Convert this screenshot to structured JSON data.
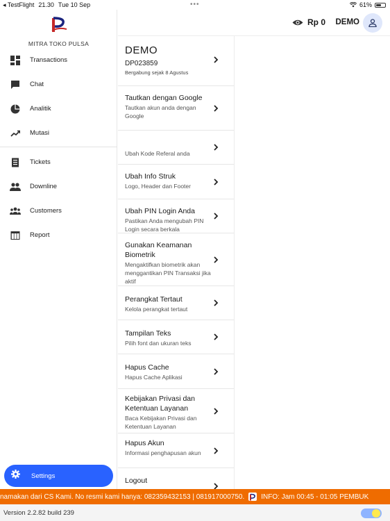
{
  "status_bar": {
    "back_app": "◂ TestFlight",
    "time": "21.30",
    "date": "Tue 10 Sep",
    "battery": "61%",
    "battery_level": 0.61
  },
  "brand": {
    "name": "MITRA TOKO PULSA"
  },
  "sidebar": {
    "group1": [
      {
        "label": "Transactions",
        "icon": "dashboard-icon"
      },
      {
        "label": "Chat",
        "icon": "chat-icon"
      },
      {
        "label": "Analitik",
        "icon": "pie-chart-icon"
      },
      {
        "label": "Mutasi",
        "icon": "trending-up-icon"
      }
    ],
    "group2": [
      {
        "label": "Tickets",
        "icon": "receipt-icon"
      },
      {
        "label": "Downline",
        "icon": "people-icon"
      },
      {
        "label": "Customers",
        "icon": "groups-icon"
      },
      {
        "label": "Report",
        "icon": "table-icon"
      }
    ],
    "settings_label": "Settings"
  },
  "header": {
    "balance": "Rp 0",
    "user": "DEMO"
  },
  "profile": {
    "name": "DEMO",
    "id": "DP023859",
    "joined": "Bergabung sejak 8 Agustus"
  },
  "settings": [
    {
      "title": "Tautkan dengan Google",
      "sub": "Tautkan akun anda dengan Google"
    },
    {
      "title": "",
      "sub": "Ubah Kode Referal anda"
    },
    {
      "title": "Ubah Info Struk",
      "sub": "Logo, Header dan Footer"
    },
    {
      "title": "Ubah PIN Login Anda",
      "sub": "Pastikan Anda mengubah PIN Login secara berkala"
    },
    {
      "title": "Gunakan Keamanan Biometrik",
      "sub": "Mengaktifkan biometrik akan menggantikan PIN Transaksi jika aktif"
    },
    {
      "title": "Perangkat Tertaut",
      "sub": "Kelola perangkat tertaut"
    },
    {
      "title": "Tampilan Teks",
      "sub": "Pilih font dan ukuran teks"
    },
    {
      "title": "Hapus Cache",
      "sub": "Hapus Cache Aplikasi"
    },
    {
      "title": "Kebijakan Privasi dan Ketentuan Layanan",
      "sub": "Baca Kebijakan Privasi dan Ketentuan Layanan"
    },
    {
      "title": "Hapus Akun",
      "sub": "Informasi penghapusan akun"
    },
    {
      "title": "Logout",
      "sub": ""
    }
  ],
  "ticker": {
    "text1": "namakan dari CS Kami. No resmi kami hanya: 082359432153 | 081917000750.",
    "text2": "INFO: Jam 00:45 - 01:05 PEMBUK"
  },
  "footer": {
    "version": "Version 2.2.82 build 239"
  },
  "colors": {
    "accent": "#2962ff",
    "ticker": "#ef6c00",
    "avatar_bg": "#dfe7fb"
  }
}
